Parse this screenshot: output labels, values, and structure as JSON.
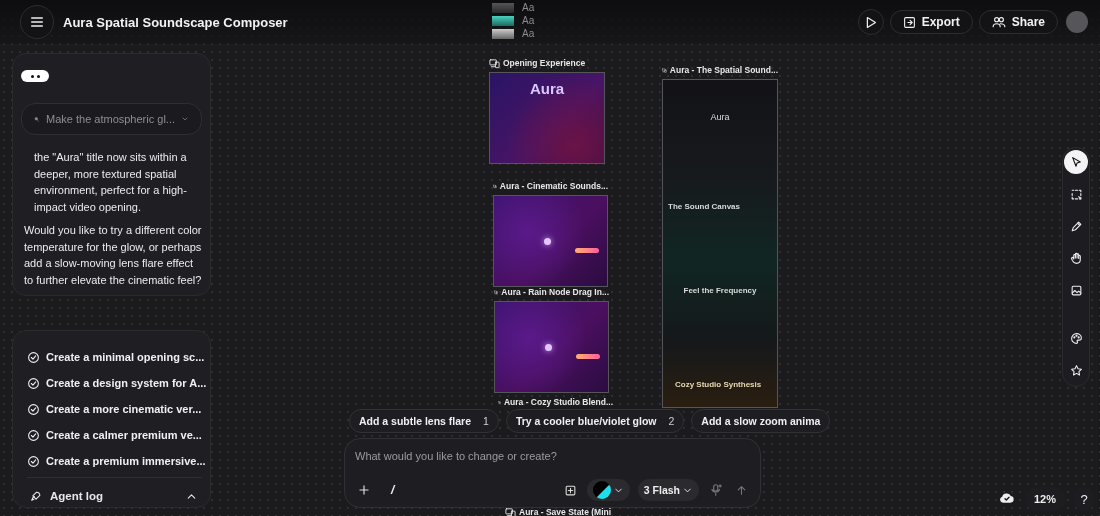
{
  "app": {
    "title": "Aura Spatial Soundscape Composer"
  },
  "header_actions": [
    {
      "kind": "play"
    },
    {
      "kind": "export",
      "label": "Export"
    },
    {
      "kind": "share",
      "label": "Share"
    }
  ],
  "chat": {
    "prompt_chip": "Make the atmospheric gl...",
    "reply": "the \"Aura\" title now sits within a deeper, more textured spatial environment, perfect for a high-impact video opening.",
    "question": "Would you like to try a different color temperature for the glow, or perhaps add a slow-moving lens flare effect to further elevate the cinematic feel?"
  },
  "tasks": {
    "items": [
      {
        "label": "Create a minimal opening sc...",
        "done": true
      },
      {
        "label": "Create a design system for A...",
        "done": true
      },
      {
        "label": "Create a more cinematic ver...",
        "done": true
      },
      {
        "label": "Create a calmer premium ve...",
        "done": true
      },
      {
        "label": "Create a premium immersive...",
        "done": true
      }
    ],
    "footer": {
      "label": "Agent log",
      "expanded": true
    }
  },
  "frames": [
    {
      "kind": "typescale",
      "samples": [
        "Aa",
        "Aa",
        "Aa"
      ]
    },
    {
      "kind": "opening",
      "title": "Opening Experience",
      "preview_texts": [
        "Aura"
      ]
    },
    {
      "kind": "tall",
      "title": "Aura - The Spatial Sound...",
      "preview_texts": [
        "Aura",
        "The Sound Canvas",
        "Feel the Frequency",
        "Cozy Studio Synthesis"
      ]
    },
    {
      "kind": "purple",
      "title": "Aura - Cinematic Sounds..."
    },
    {
      "kind": "purple",
      "title": "Aura - Rain Node Drag In..."
    },
    {
      "kind": "label_only",
      "title": "Aura - Cozy Studio Blend..."
    },
    {
      "kind": "label_only",
      "title": "Aura - Save State (Mini"
    }
  ],
  "suggestions": [
    {
      "label": "Add a subtle lens flare",
      "count": "1"
    },
    {
      "label": "Try a cooler blue/violet glow",
      "count": "2"
    },
    {
      "label": "Add a slow zoom anima"
    }
  ],
  "composer": {
    "placeholder": "What would you like to change or create?",
    "slash": "/",
    "model": "3 Flash"
  },
  "tools": [
    {
      "kind": "select",
      "selected": true
    },
    {
      "kind": "marquee",
      "selected": false
    },
    {
      "kind": "pencil",
      "selected": false
    },
    {
      "kind": "hand",
      "selected": false
    },
    {
      "kind": "image",
      "selected": false
    },
    {
      "kind": "palette",
      "selected": false
    },
    {
      "kind": "star",
      "selected": false
    }
  ],
  "zoom": {
    "level_text": "12%",
    "help": "?"
  }
}
